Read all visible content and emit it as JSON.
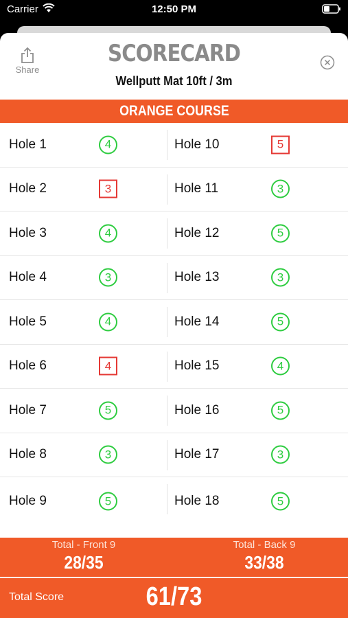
{
  "status_bar": {
    "carrier": "Carrier",
    "time": "12:50 PM"
  },
  "header": {
    "share_label": "Share",
    "title": "SCORECARD",
    "subtitle": "Wellputt Mat 10ft / 3m"
  },
  "course": {
    "name": "ORANGE COURSE"
  },
  "rows": [
    {
      "left": {
        "label": "Hole 1",
        "score": "4",
        "status": "par"
      },
      "right": {
        "label": "Hole 10",
        "score": "5",
        "status": "over"
      }
    },
    {
      "left": {
        "label": "Hole 2",
        "score": "3",
        "status": "over"
      },
      "right": {
        "label": "Hole 11",
        "score": "3",
        "status": "par"
      }
    },
    {
      "left": {
        "label": "Hole 3",
        "score": "4",
        "status": "par"
      },
      "right": {
        "label": "Hole 12",
        "score": "5",
        "status": "par"
      }
    },
    {
      "left": {
        "label": "Hole 4",
        "score": "3",
        "status": "par"
      },
      "right": {
        "label": "Hole 13",
        "score": "3",
        "status": "par"
      }
    },
    {
      "left": {
        "label": "Hole 5",
        "score": "4",
        "status": "par"
      },
      "right": {
        "label": "Hole 14",
        "score": "5",
        "status": "par"
      }
    },
    {
      "left": {
        "label": "Hole 6",
        "score": "4",
        "status": "over"
      },
      "right": {
        "label": "Hole 15",
        "score": "4",
        "status": "par"
      }
    },
    {
      "left": {
        "label": "Hole 7",
        "score": "5",
        "status": "par"
      },
      "right": {
        "label": "Hole 16",
        "score": "5",
        "status": "par"
      }
    },
    {
      "left": {
        "label": "Hole 8",
        "score": "3",
        "status": "par"
      },
      "right": {
        "label": "Hole 17",
        "score": "3",
        "status": "par"
      }
    },
    {
      "left": {
        "label": "Hole 9",
        "score": "5",
        "status": "par"
      },
      "right": {
        "label": "Hole 18",
        "score": "5",
        "status": "par"
      }
    }
  ],
  "totals": {
    "front_label": "Total - Front 9",
    "front_value": "28/35",
    "back_label": "Total - Back 9",
    "back_value": "33/38",
    "total_label": "Total Score",
    "total_value": "61/73"
  },
  "colors": {
    "accent": "#f05a28",
    "par_green": "#2ecc40",
    "over_red": "#e53935",
    "title_gray": "#8a8a8a"
  },
  "icons": {
    "share": "share-icon",
    "close": "close-icon",
    "wifi": "wifi-icon",
    "battery": "battery-icon"
  }
}
